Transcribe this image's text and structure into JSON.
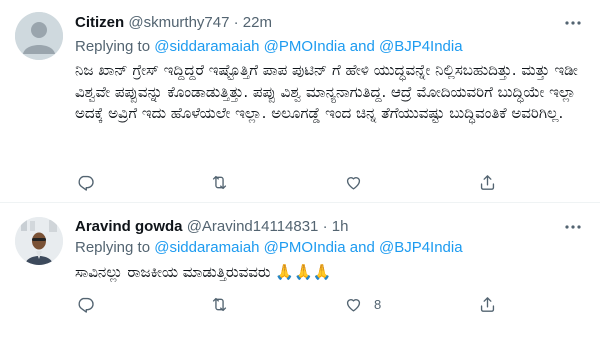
{
  "tweets": [
    {
      "name": "Citizen",
      "handle": "@skmurthy747",
      "separator": "·",
      "time": "22m",
      "more_icon": "more-dots",
      "reply_prefix": "Replying to ",
      "mention_1": "@siddaramaiah",
      "mention_2": "@PMOIndia",
      "reply_and": " and ",
      "mention_3": "@BJP4India",
      "text": "ನಿಜ ಖಾನ್ ಗ್ರೇಸ್ ಇದ್ದಿದ್ದರೆ ಇಷ್ಟೊತ್ತಿಗೆ ಪಾಪ ಪುಟಿನ್ ಗೆ ಹೇಳಿ ಯುದ್ಧವನ್ನೇ ನಿಲ್ಲಿಸಬಹುದಿತ್ತು. ಮತ್ತು ಇಡೀ ವಿಶ್ವವೇ ಪಪ್ಪುವನ್ನು ಕೊಂಡಾಡುತ್ತಿತ್ತು. ಪಪ್ಪು ವಿಶ್ವ ಮಾನ್ಯನಾಗುತಿದ್ದ. ಆದ್ರೆ ಮೋದಿಯವರಿಗೆ ಬುದ್ಧಿಯೇ ಇಲ್ಲಾ ಅದಕ್ಕೆ ಅವ್ರಿಗೆ ಇದು ಹೊಳೆಯಲೇ ಇಲ್ಲಾ. ಅಲೂಗಡ್ಡೆ ಇಂದ ಚಿನ್ನ ತೆಗೆಯುವಷ್ಟು ಬುದ್ಧಿವಂತಿಕೆ ಅವರಿಗಿಲ್ಲ.",
      "like_count": ""
    },
    {
      "name": "Aravind gowda",
      "handle": "@Aravind14114831",
      "separator": "·",
      "time": "1h",
      "more_icon": "more-dots",
      "reply_prefix": "Replying to ",
      "mention_1": "@siddaramaiah",
      "mention_2": "@PMOIndia",
      "reply_and": " and ",
      "mention_3": "@BJP4India",
      "text": "ಸಾವಿನಲ್ಲು ರಾಜಕೀಯ ಮಾಡುತ್ತಿರುವವರು 🙏🙏🙏",
      "like_count": "8"
    }
  ],
  "icons": {
    "reply": "reply-icon",
    "retweet": "retweet-icon",
    "like": "heart-icon",
    "share": "share-icon"
  },
  "colors": {
    "text": "#0f1419",
    "muted": "#536471",
    "link": "#1d9bf0",
    "divider": "#eff3f4"
  }
}
